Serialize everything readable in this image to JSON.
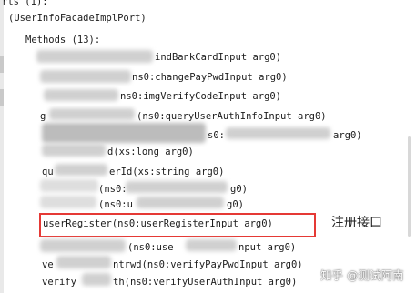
{
  "tree": {
    "ports_header": "rts (1):",
    "port_name": "(UserInfoFacadeImplPort)",
    "methods_header": "Methods (13):",
    "lines": [
      "indBankCardInput arg0)",
      "ns0:changePayPwdInput arg0)",
      "ns0:imgVerifyCodeInput arg0)",
      "(ns0:queryUserAuthInfoInput arg0)",
      "s0:",
      "arg0)",
      "d(xs:long arg0)",
      "erId(xs:string arg0)",
      "(ns0:",
      "g0)",
      "(ns0:u",
      "g0)",
      "userRegister(ns0:userRegisterInput arg0)",
      "(ns0:use",
      "nput arg0)",
      "ntrwd(ns0:verifyPayPwdInput arg0)",
      "th(ns0:verifyUserAuthInput arg0)"
    ],
    "prefixes": {
      "line_3": "g",
      "line_6": "qu",
      "line_11": "ve",
      "line_12": "verify"
    }
  },
  "annotation": {
    "label": "注册接口",
    "color": "#e53935"
  },
  "watermark": {
    "text": "知乎 @测试阿南"
  }
}
